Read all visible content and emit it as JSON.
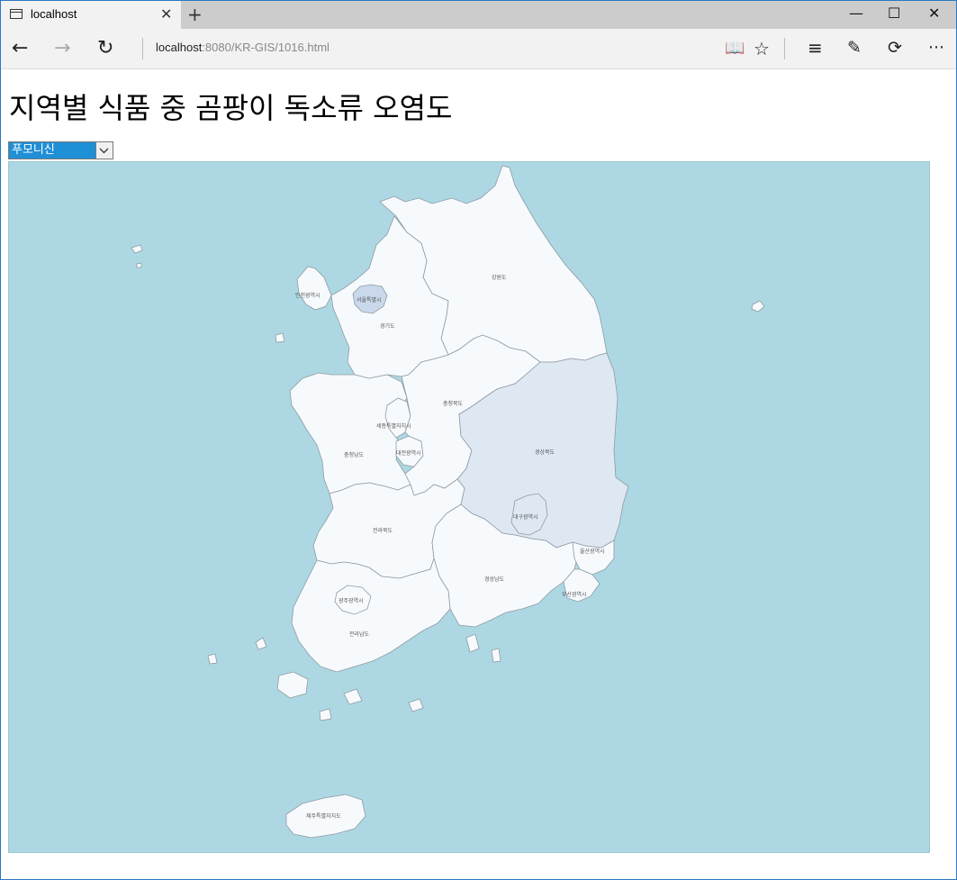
{
  "browser": {
    "tab_title": "localhost",
    "url_host": "localhost",
    "url_path": ":8080/KR-GIS/1016.html"
  },
  "page": {
    "title": "지역별 식품 중 곰팡이 독소류 오염도",
    "toxin_select": {
      "selected": "푸모니신"
    }
  },
  "map": {
    "sea_color": "#add8e3",
    "land_color": "#f7fafd",
    "highlight_colors": [
      "#dde8f3",
      "#c9d8ea"
    ],
    "regions": [
      {
        "id": "gangwon",
        "label": "강원도",
        "level": 0
      },
      {
        "id": "gyeonggi",
        "label": "경기도",
        "level": 0
      },
      {
        "id": "seoul",
        "label": "서울특별시",
        "level": 2
      },
      {
        "id": "incheon",
        "label": "인천광역시",
        "level": 0
      },
      {
        "id": "chungbuk",
        "label": "충청북도",
        "level": 0
      },
      {
        "id": "chungnam",
        "label": "충청남도",
        "level": 0
      },
      {
        "id": "sejong",
        "label": "세종특별자치시",
        "level": 0
      },
      {
        "id": "daejeon",
        "label": "대전광역시",
        "level": 0
      },
      {
        "id": "gyeongbuk",
        "label": "경상북도",
        "level": 1
      },
      {
        "id": "daegu",
        "label": "대구광역시",
        "level": 1
      },
      {
        "id": "jeonbuk",
        "label": "전라북도",
        "level": 0
      },
      {
        "id": "gwangju",
        "label": "광주광역시",
        "level": 0
      },
      {
        "id": "jeonnam",
        "label": "전라남도",
        "level": 0
      },
      {
        "id": "gyeongnam",
        "label": "경상남도",
        "level": 0
      },
      {
        "id": "ulsan",
        "label": "울산광역시",
        "level": 0
      },
      {
        "id": "busan",
        "label": "부산광역시",
        "level": 0
      },
      {
        "id": "jeju",
        "label": "제주특별자치도",
        "level": 0
      }
    ]
  }
}
